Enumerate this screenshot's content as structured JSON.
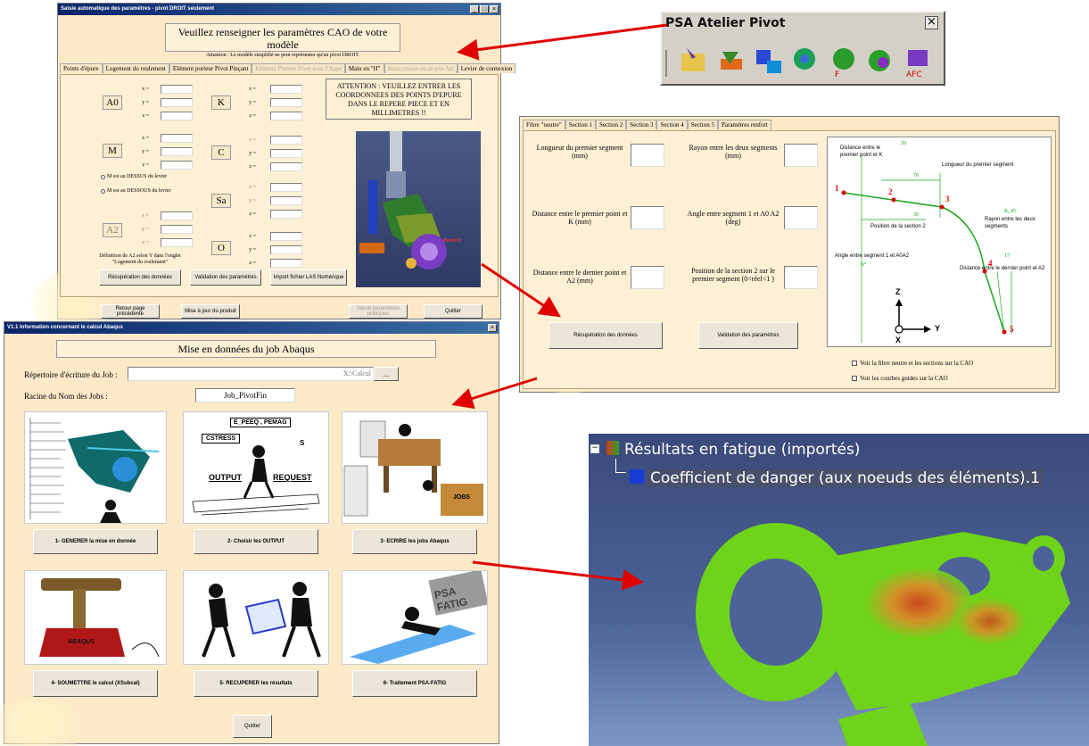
{
  "win_top": {
    "title": "Saisie automatique des paramètres - pivot DROIT seulement",
    "heading_line1": "Veuillez renseigner les paramètres CAO de votre",
    "heading_line2": "modèle",
    "note": "Attention : Le modèle simplifié ne peut représenter qu'un pivot DROIT.",
    "tabs": [
      "Points d'épure",
      "Logement du roulement",
      "Elément porteur Pivot Pinçant",
      "Elément Porteur Pivot avec Chape",
      "Main en \"H\"",
      "Main creuse ou de pré-Ats",
      "Levier de connexion"
    ],
    "point_labels": [
      "A0",
      "M",
      "A2",
      "K",
      "C",
      "Sa",
      "O"
    ],
    "coord_labels": [
      "x =",
      "y =",
      "z ="
    ],
    "warning": "ATTENTION : VEUILLEZ ENTRER LES COORDONNEES DES POINTS D'EPURE DANS LE REPERE PIECE ET EN MILLIMETRES !!",
    "radio_above": "M est au DESSUS du levier",
    "radio_below": "M est au DESSOUS du levier",
    "a2_note": "Définition de A2 selon Y dans l'onglet \"Logement du roulement\"",
    "buttons": [
      "Récupération des données",
      "Validation des paramètres",
      "Import fichier LAS Numérique"
    ],
    "bottom_buttons": [
      "Retour page précédente",
      "Mise à jour du produit",
      "Saisie paramètres pratiques",
      "Quitter"
    ],
    "point_marker": "Point O"
  },
  "toolbar": {
    "title": "PSA Atelier Pivot",
    "close": "×"
  },
  "win_right": {
    "tabs": [
      "Fibre \"neutre\"",
      "Section 1",
      "Section 2",
      "Section 3",
      "Section 4",
      "Section 5",
      "Paramètres renfort"
    ],
    "fields": [
      "Longueur du premier segment (mm)",
      "Rayon entre les deux segments (mm)",
      "Distance entre le premier point et K (mm)",
      "Angle entre segment 1 et A0 A2 (deg)",
      "Distance entre le dernier point et A2 (mm)",
      "Position de la section 2 sur le premier segment (0<réel<1 )"
    ],
    "buttons": [
      "Récupération des données",
      "Validation des paramètres"
    ],
    "checkboxes": [
      "Voir la fibre neutre et les sections sur la CAO",
      "Voir les courbes guides sur la CAO"
    ],
    "sketch": {
      "dist_k": "Distance entre le premier point et K",
      "len_first": "Longueur du premier segment",
      "pos_sec2": "Position de la section 2",
      "radius": "Rayon entre les deux segments",
      "angle": "Angle entre segment 1 et A0A2",
      "dist_last": "Distance entre le dernier point et A2",
      "n20": "20",
      "n78": "78",
      "n39": "39",
      "r45": "R_45",
      "n17": "17",
      "n6": "6°",
      "p1": "1",
      "p2": "2",
      "p3": "3",
      "p4": "4",
      "p5": "5",
      "ax_z": "Z",
      "ax_y": "Y",
      "ax_x": "X"
    }
  },
  "win_bottom": {
    "title": "V1.1 Information concernant le calcul Abaqus",
    "heading": "Mise en données du job Abaqus",
    "dir_label": "Répertoire d'écriture du Job :",
    "dir_value": "X:\\Calcul",
    "browse": "...",
    "root_label": "Racine du Nom des Jobs :",
    "root_value": "Job_PivotFin",
    "steps": [
      "1- GENERER la mise en donnée",
      "2- Choisir les OUTPUT",
      "3- ECRIRE les jobs Abaqus",
      "4- SOUMETTRE le calcul  (XSubcal)",
      "5- RECUPERER les résultats",
      "6- Traitement PSA-FATIG"
    ],
    "pic2_texts": [
      "E_PEEQ , PEMAG",
      "CSTRESS",
      "S",
      "OUTPUT",
      "REQUEST"
    ],
    "pic3_text": "JOBS",
    "pic6_text": "PSA FATIG",
    "pic4_text": "ABAQUS",
    "quit": "Quitter"
  },
  "result": {
    "tree_parent": "Résultats en fatigue (importés)",
    "tree_child": "Coefficient de danger (aux noeuds des éléments).1"
  },
  "colors": {
    "panel": "#fbe9c8",
    "arrow": "#e00000",
    "titlebar": "#0a246a",
    "mesh_green": "#6fd31a"
  }
}
